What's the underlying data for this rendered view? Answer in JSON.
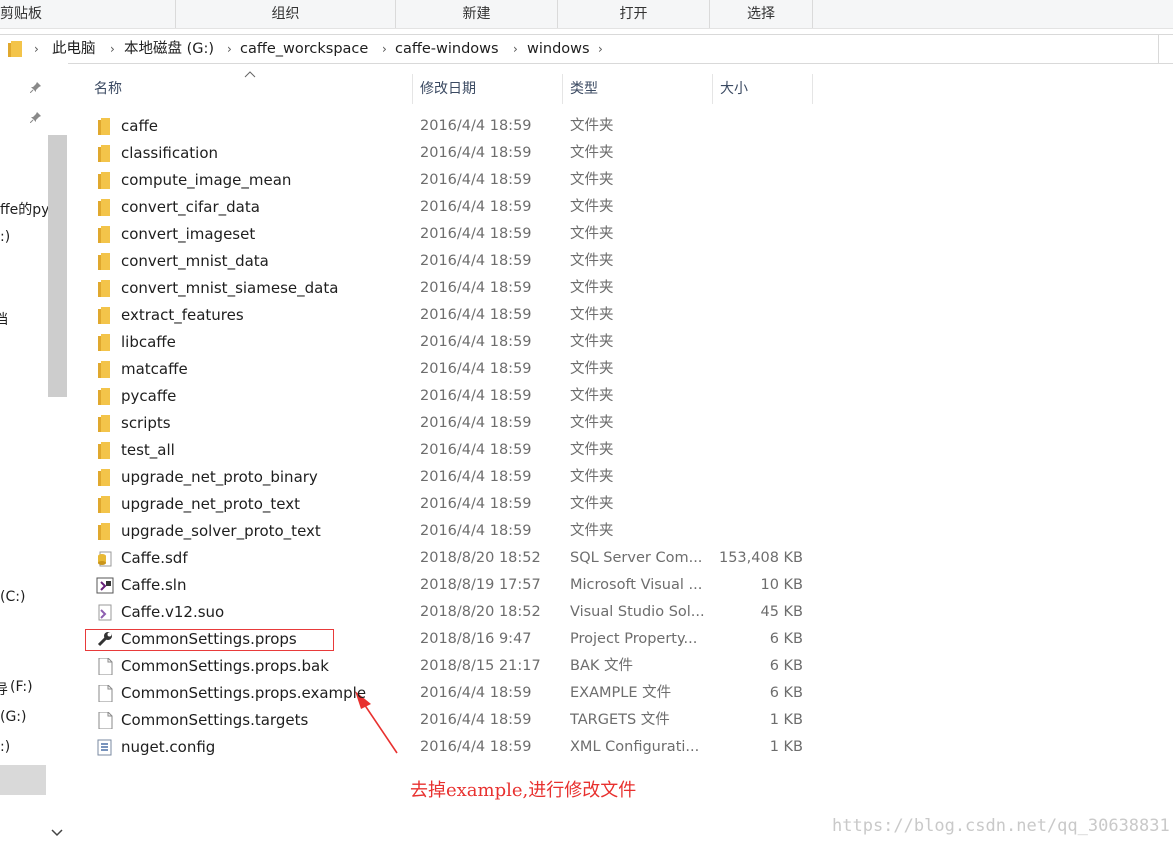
{
  "ribbon": {
    "groups": [
      "剪贴板",
      "组织",
      "新建",
      "打开",
      "选择"
    ]
  },
  "address": {
    "breadcrumbs": [
      "此电脑",
      "本地磁盘 (G:)",
      "caffe_worckspace",
      "caffe-windows",
      "windows"
    ]
  },
  "nav": {
    "items": [
      "ffe的py",
      ":)",
      "(C:)",
      "(F:)",
      "(G:)",
      ":)"
    ],
    "truncated_char": "档",
    "truncated_char2": "导"
  },
  "columns": {
    "name": "名称",
    "date": "修改日期",
    "type": "类型",
    "size": "大小"
  },
  "files": [
    {
      "icon": "folder-icon",
      "name": "caffe",
      "date": "2016/4/4 18:59",
      "type": "文件夹",
      "size": ""
    },
    {
      "icon": "folder-icon",
      "name": "classification",
      "date": "2016/4/4 18:59",
      "type": "文件夹",
      "size": ""
    },
    {
      "icon": "folder-icon",
      "name": "compute_image_mean",
      "date": "2016/4/4 18:59",
      "type": "文件夹",
      "size": ""
    },
    {
      "icon": "folder-icon",
      "name": "convert_cifar_data",
      "date": "2016/4/4 18:59",
      "type": "文件夹",
      "size": ""
    },
    {
      "icon": "folder-icon",
      "name": "convert_imageset",
      "date": "2016/4/4 18:59",
      "type": "文件夹",
      "size": ""
    },
    {
      "icon": "folder-icon",
      "name": "convert_mnist_data",
      "date": "2016/4/4 18:59",
      "type": "文件夹",
      "size": ""
    },
    {
      "icon": "folder-icon",
      "name": "convert_mnist_siamese_data",
      "date": "2016/4/4 18:59",
      "type": "文件夹",
      "size": ""
    },
    {
      "icon": "folder-icon",
      "name": "extract_features",
      "date": "2016/4/4 18:59",
      "type": "文件夹",
      "size": ""
    },
    {
      "icon": "folder-icon",
      "name": "libcaffe",
      "date": "2016/4/4 18:59",
      "type": "文件夹",
      "size": ""
    },
    {
      "icon": "folder-icon",
      "name": "matcaffe",
      "date": "2016/4/4 18:59",
      "type": "文件夹",
      "size": ""
    },
    {
      "icon": "folder-icon",
      "name": "pycaffe",
      "date": "2016/4/4 18:59",
      "type": "文件夹",
      "size": ""
    },
    {
      "icon": "folder-icon",
      "name": "scripts",
      "date": "2016/4/4 18:59",
      "type": "文件夹",
      "size": ""
    },
    {
      "icon": "folder-icon",
      "name": "test_all",
      "date": "2016/4/4 18:59",
      "type": "文件夹",
      "size": ""
    },
    {
      "icon": "folder-icon",
      "name": "upgrade_net_proto_binary",
      "date": "2016/4/4 18:59",
      "type": "文件夹",
      "size": ""
    },
    {
      "icon": "folder-icon",
      "name": "upgrade_net_proto_text",
      "date": "2016/4/4 18:59",
      "type": "文件夹",
      "size": ""
    },
    {
      "icon": "folder-icon",
      "name": "upgrade_solver_proto_text",
      "date": "2016/4/4 18:59",
      "type": "文件夹",
      "size": ""
    },
    {
      "icon": "sql-database-icon",
      "name": "Caffe.sdf",
      "date": "2018/8/20 18:52",
      "type": "SQL Server Com...",
      "size": "153,408 KB"
    },
    {
      "icon": "visual-studio-solution-icon",
      "name": "Caffe.sln",
      "date": "2018/8/19 17:57",
      "type": "Microsoft Visual ...",
      "size": "10 KB"
    },
    {
      "icon": "visual-studio-suo-icon",
      "name": "Caffe.v12.suo",
      "date": "2018/8/20 18:52",
      "type": "Visual Studio Sol...",
      "size": "45 KB"
    },
    {
      "icon": "wrench-icon",
      "name": "CommonSettings.props",
      "date": "2018/8/16 9:47",
      "type": "Project Property...",
      "size": "6 KB"
    },
    {
      "icon": "document-icon",
      "name": "CommonSettings.props.bak",
      "date": "2018/8/15 21:17",
      "type": "BAK 文件",
      "size": "6 KB"
    },
    {
      "icon": "document-icon",
      "name": "CommonSettings.props.example",
      "date": "2016/4/4 18:59",
      "type": "EXAMPLE 文件",
      "size": "6 KB"
    },
    {
      "icon": "document-icon",
      "name": "CommonSettings.targets",
      "date": "2016/4/4 18:59",
      "type": "TARGETS 文件",
      "size": "1 KB"
    },
    {
      "icon": "config-file-icon",
      "name": "nuget.config",
      "date": "2016/4/4 18:59",
      "type": "XML Configurati...",
      "size": "1 KB"
    }
  ],
  "annotation": {
    "text": "去掉example,进行修改文件",
    "color": "#e8312f"
  },
  "watermark": "https://blog.csdn.net/qq_30638831",
  "colors": {
    "folder": "#f3c44a",
    "annotation_red": "#e83a3a"
  }
}
